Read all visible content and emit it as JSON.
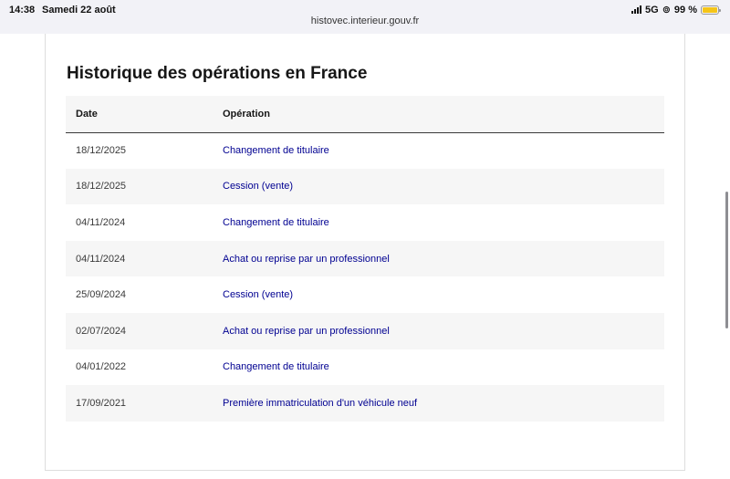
{
  "status_bar": {
    "time": "14:38",
    "date": "Samedi 22 août",
    "network": "5G",
    "battery_text": "99 %",
    "battery_level": 0.99
  },
  "browser": {
    "url": "histovec.interieur.gouv.fr"
  },
  "section": {
    "title": "Historique des opérations en France"
  },
  "table": {
    "headers": {
      "date": "Date",
      "operation": "Opération"
    },
    "rows": [
      {
        "date": "18/12/2025",
        "operation": "Changement de titulaire"
      },
      {
        "date": "18/12/2025",
        "operation": "Cession (vente)"
      },
      {
        "date": "04/11/2024",
        "operation": "Changement de titulaire"
      },
      {
        "date": "04/11/2024",
        "operation": "Achat ou reprise par un professionnel"
      },
      {
        "date": "25/09/2024",
        "operation": "Cession (vente)"
      },
      {
        "date": "02/07/2024",
        "operation": "Achat ou reprise par un professionnel"
      },
      {
        "date": "04/01/2022",
        "operation": "Changement de titulaire"
      },
      {
        "date": "17/09/2021",
        "operation": "Première immatriculation d'un véhicule neuf"
      }
    ]
  },
  "colors": {
    "link": "#000091",
    "stripe": "#f6f6f6",
    "battery": "#f5c518"
  }
}
